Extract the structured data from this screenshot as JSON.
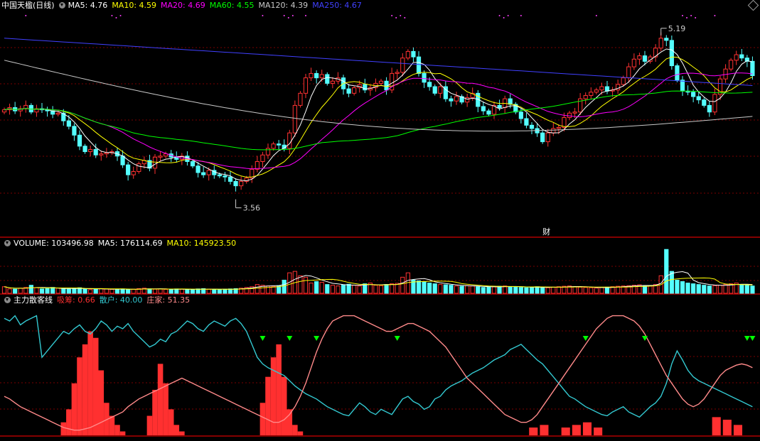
{
  "colors": {
    "background": "#000000",
    "up_candle": "#ff3232",
    "down_candle": "#54ffff",
    "grid": "#7a0000",
    "ma5": "#ffffff",
    "ma10": "#ffff00",
    "ma20": "#ff00ff",
    "ma60": "#00ff00",
    "ma120": "#c8c8c8",
    "ma250": "#4040ff",
    "xichou": "#ff3030",
    "sanhu": "#33c8d0",
    "zhuangjia": "#ff8a8a",
    "signal": "#00ff00"
  },
  "main_panel": {
    "title": "中国天楹(日线)",
    "indicators": [
      {
        "label": "MA5: 4.76",
        "color": "#ffffff"
      },
      {
        "label": "MA10: 4.59",
        "color": "#ffff00"
      },
      {
        "label": "MA20: 4.69",
        "color": "#ff00ff"
      },
      {
        "label": "MA60: 4.55",
        "color": "#00ff00"
      },
      {
        "label": "MA120: 4.39",
        "color": "#c8c8c8"
      },
      {
        "label": "MA250: 4.67",
        "color": "#4040ff"
      }
    ],
    "high_label": "5.19",
    "low_label": "3.56",
    "cai_marker": "财"
  },
  "volume_panel": {
    "label": "VOLUME: 103496.98",
    "indicators": [
      {
        "label": "MA5: 176114.69",
        "color": "#ffffff"
      },
      {
        "label": "MA10: 145923.50",
        "color": "#ffff00"
      }
    ]
  },
  "indicator_panel": {
    "name": "主力散客线",
    "indicators": [
      {
        "label": "吸筹: 0.66",
        "color": "#ff3030"
      },
      {
        "label": "散户: 40.00",
        "color": "#33c8d0"
      },
      {
        "label": "庄家: 51.35",
        "color": "#ff8a8a"
      }
    ]
  },
  "chart_data": [
    {
      "type": "candlestick",
      "title": "中国天楹(日线)",
      "ylim": [
        3.3,
        5.35
      ],
      "high": 5.19,
      "low": 3.56,
      "series": [
        {
          "name": "MA5",
          "value": 4.76
        },
        {
          "name": "MA10",
          "value": 4.59
        },
        {
          "name": "MA20",
          "value": 4.69
        },
        {
          "name": "MA60",
          "value": 4.55
        },
        {
          "name": "MA120",
          "value": 4.39
        },
        {
          "name": "MA250",
          "value": 4.67
        }
      ],
      "close": [
        4.45,
        4.47,
        4.44,
        4.46,
        4.49,
        4.43,
        4.46,
        4.45,
        4.44,
        4.41,
        4.42,
        4.35,
        4.3,
        4.22,
        4.12,
        4.07,
        4.09,
        4.04,
        4.05,
        4.06,
        4.07,
        4.03,
        3.95,
        3.86,
        3.89,
        3.96,
        3.99,
        3.92,
        4.02,
        4.03,
        4.05,
        4.02,
        4.0,
        4.03,
        3.98,
        3.94,
        3.88,
        3.86,
        3.9,
        3.86,
        3.85,
        3.84,
        3.8,
        3.76,
        3.8,
        3.83,
        3.91,
        3.98,
        4.04,
        4.1,
        4.14,
        4.13,
        4.1,
        4.24,
        4.49,
        4.6,
        4.74,
        4.78,
        4.74,
        4.77,
        4.69,
        4.71,
        4.74,
        4.64,
        4.6,
        4.65,
        4.68,
        4.63,
        4.65,
        4.69,
        4.71,
        4.63,
        4.78,
        4.79,
        4.92,
        4.98,
        4.93,
        4.78,
        4.7,
        4.66,
        4.6,
        4.66,
        4.55,
        4.53,
        4.57,
        4.52,
        4.56,
        4.6,
        4.48,
        4.44,
        4.41,
        4.49,
        4.47,
        4.55,
        4.5,
        4.43,
        4.37,
        4.31,
        4.28,
        4.24,
        4.16,
        4.24,
        4.28,
        4.29,
        4.38,
        4.42,
        4.43,
        4.55,
        4.58,
        4.61,
        4.63,
        4.66,
        4.62,
        4.63,
        4.68,
        4.74,
        4.84,
        4.91,
        4.94,
        4.89,
        4.93,
        5.01,
        5.1,
        5.08,
        4.85,
        4.72,
        4.62,
        4.61,
        4.57,
        4.54,
        4.49,
        4.43,
        4.59,
        4.73,
        4.82,
        4.9,
        4.95,
        4.92,
        4.89,
        4.76
      ],
      "volume": [
        45,
        30,
        28,
        35,
        40,
        55,
        38,
        30,
        32,
        40,
        36,
        30,
        28,
        35,
        38,
        30,
        25,
        28,
        32,
        30,
        27,
        26,
        30,
        25,
        28,
        32,
        35,
        30,
        28,
        30,
        27,
        26,
        30,
        28,
        25,
        27,
        30,
        32,
        28,
        26,
        25,
        28,
        30,
        32,
        35,
        40,
        45,
        60,
        55,
        50,
        48,
        52,
        90,
        140,
        150,
        120,
        110,
        70,
        80,
        75,
        60,
        55,
        50,
        58,
        62,
        55,
        50,
        65,
        70,
        55,
        52,
        60,
        65,
        68,
        110,
        140,
        90,
        85,
        80,
        70,
        65,
        60,
        58,
        55,
        50,
        48,
        52,
        50,
        45,
        40,
        42,
        45,
        48,
        50,
        46,
        44,
        40,
        38,
        42,
        45,
        40,
        38,
        42,
        45,
        48,
        50,
        45,
        42,
        40,
        38,
        36,
        40,
        42,
        45,
        48,
        50,
        52,
        55,
        58,
        52,
        50,
        60,
        120,
        300,
        150,
        90,
        80,
        70,
        65,
        60,
        55,
        50,
        52,
        55,
        60,
        65,
        70,
        60,
        55,
        50
      ]
    },
    {
      "type": "bar",
      "title": "VOLUME: 103496.98",
      "series": [
        {
          "name": "MA5",
          "value": 176114.69
        },
        {
          "name": "MA10",
          "value": 145923.5
        }
      ]
    },
    {
      "type": "line",
      "title": "主力散客线",
      "ylim": [
        0,
        100
      ],
      "series": [
        {
          "name": "吸筹",
          "value": 0.66,
          "values": [
            0,
            0,
            0,
            0,
            0,
            0,
            0,
            0,
            0,
            0,
            0,
            10,
            20,
            40,
            60,
            70,
            80,
            75,
            50,
            25,
            15,
            8,
            3,
            0,
            0,
            0,
            0,
            15,
            35,
            55,
            40,
            20,
            8,
            3,
            0,
            0,
            0,
            0,
            0,
            0,
            0,
            0,
            0,
            0,
            0,
            0,
            0,
            0,
            25,
            45,
            60,
            70,
            45,
            20,
            8,
            3,
            0,
            0,
            0,
            0,
            0,
            0,
            0,
            0,
            0,
            0,
            0,
            0,
            0,
            0,
            0,
            0,
            0,
            0,
            0,
            0,
            0,
            0,
            0,
            0,
            0,
            0,
            0,
            0,
            0,
            0,
            0,
            0,
            0,
            0,
            0,
            0,
            0,
            0,
            0,
            0,
            0,
            0,
            0,
            0,
            0,
            0,
            0,
            0,
            0,
            0,
            0,
            0,
            0,
            0,
            0,
            0,
            0,
            0,
            0,
            0,
            0,
            0,
            0,
            0,
            0,
            0,
            0,
            0,
            0,
            0,
            0,
            0,
            0,
            0,
            0,
            0,
            0,
            0,
            0,
            0,
            0,
            0,
            0,
            0
          ]
        },
        {
          "name": "散户",
          "value": 40.0,
          "values": [
            90,
            88,
            92,
            85,
            88,
            90,
            92,
            60,
            65,
            70,
            75,
            80,
            78,
            82,
            85,
            80,
            78,
            82,
            88,
            85,
            80,
            84,
            82,
            86,
            80,
            76,
            72,
            68,
            70,
            74,
            72,
            78,
            80,
            84,
            88,
            86,
            82,
            80,
            85,
            88,
            86,
            84,
            88,
            90,
            86,
            80,
            70,
            60,
            55,
            52,
            50,
            48,
            46,
            42,
            38,
            35,
            32,
            30,
            28,
            25,
            22,
            20,
            18,
            16,
            15,
            20,
            25,
            22,
            18,
            16,
            20,
            18,
            16,
            22,
            28,
            30,
            26,
            24,
            20,
            22,
            28,
            30,
            35,
            38,
            40,
            42,
            45,
            48,
            50,
            52,
            55,
            58,
            60,
            62,
            66,
            68,
            70,
            66,
            62,
            58,
            55,
            50,
            45,
            40,
            35,
            30,
            28,
            25,
            22,
            20,
            18,
            16,
            15,
            18,
            20,
            22,
            18,
            16,
            14,
            18,
            22,
            25,
            30,
            40,
            55,
            65,
            58,
            50,
            45,
            42,
            40,
            38,
            36,
            34,
            32,
            30,
            28,
            26,
            24,
            22
          ]
        },
        {
          "name": "庄家",
          "value": 51.35,
          "values": [
            30,
            28,
            25,
            22,
            20,
            18,
            16,
            14,
            12,
            10,
            8,
            6,
            5,
            4,
            4,
            5,
            6,
            8,
            10,
            12,
            14,
            16,
            18,
            22,
            25,
            28,
            30,
            32,
            34,
            36,
            38,
            40,
            42,
            44,
            42,
            40,
            38,
            36,
            34,
            32,
            30,
            28,
            26,
            24,
            22,
            20,
            18,
            16,
            14,
            12,
            10,
            10,
            12,
            16,
            22,
            30,
            40,
            52,
            64,
            74,
            82,
            88,
            90,
            92,
            92,
            92,
            90,
            88,
            86,
            84,
            82,
            80,
            80,
            82,
            84,
            86,
            86,
            84,
            82,
            80,
            76,
            72,
            68,
            62,
            56,
            50,
            44,
            40,
            36,
            32,
            28,
            24,
            20,
            16,
            14,
            12,
            10,
            10,
            12,
            16,
            22,
            28,
            34,
            40,
            46,
            52,
            58,
            64,
            70,
            76,
            82,
            86,
            90,
            92,
            92,
            92,
            90,
            88,
            84,
            78,
            70,
            62,
            54,
            46,
            40,
            34,
            28,
            24,
            22,
            24,
            28,
            34,
            40,
            46,
            50,
            52,
            54,
            55,
            54,
            52
          ]
        }
      ],
      "signal_markers_count": 9
    }
  ]
}
